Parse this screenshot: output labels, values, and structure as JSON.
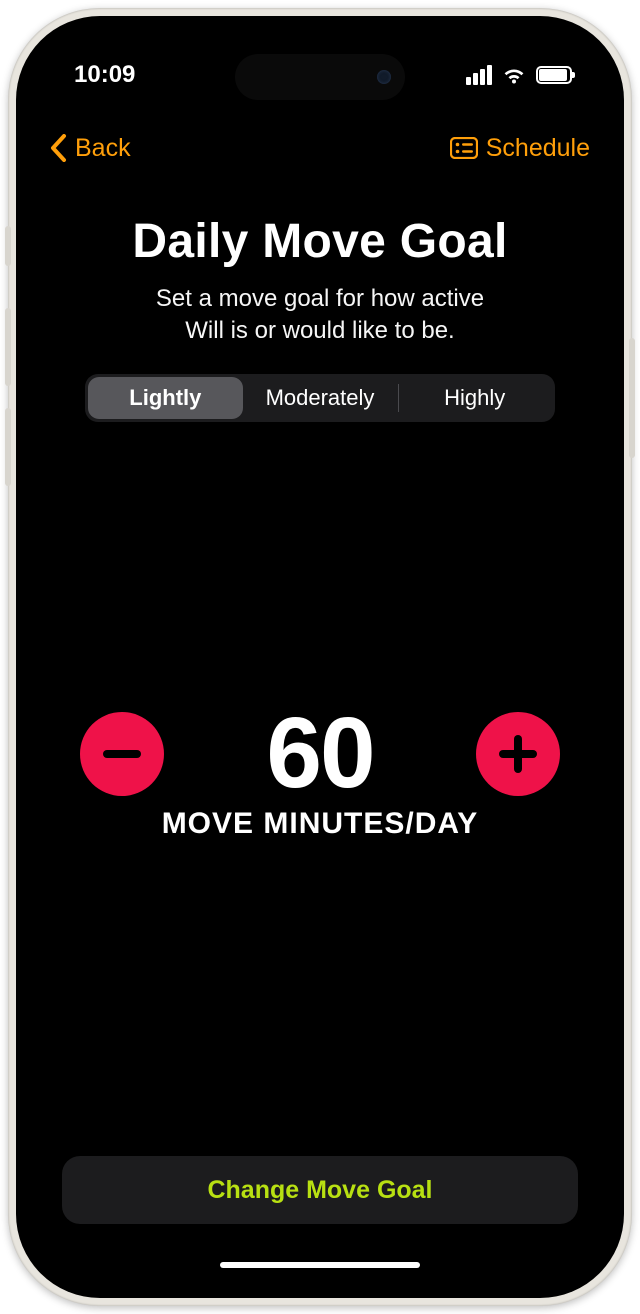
{
  "status": {
    "time": "10:09"
  },
  "nav": {
    "back_label": "Back",
    "schedule_label": "Schedule"
  },
  "page": {
    "title": "Daily Move Goal",
    "subtitle_line1": "Set a move goal for how active",
    "subtitle_line2": "Will is or would like to be."
  },
  "segments": {
    "options": [
      "Lightly",
      "Moderately",
      "Highly"
    ],
    "selected": "Lightly"
  },
  "goal": {
    "value": "60",
    "unit": "MOVE MINUTES/DAY"
  },
  "cta": {
    "label": "Change Move Goal"
  },
  "colors": {
    "accent": "#ff9f0a",
    "stepper": "#ef1249",
    "cta_text": "#b8e012"
  }
}
